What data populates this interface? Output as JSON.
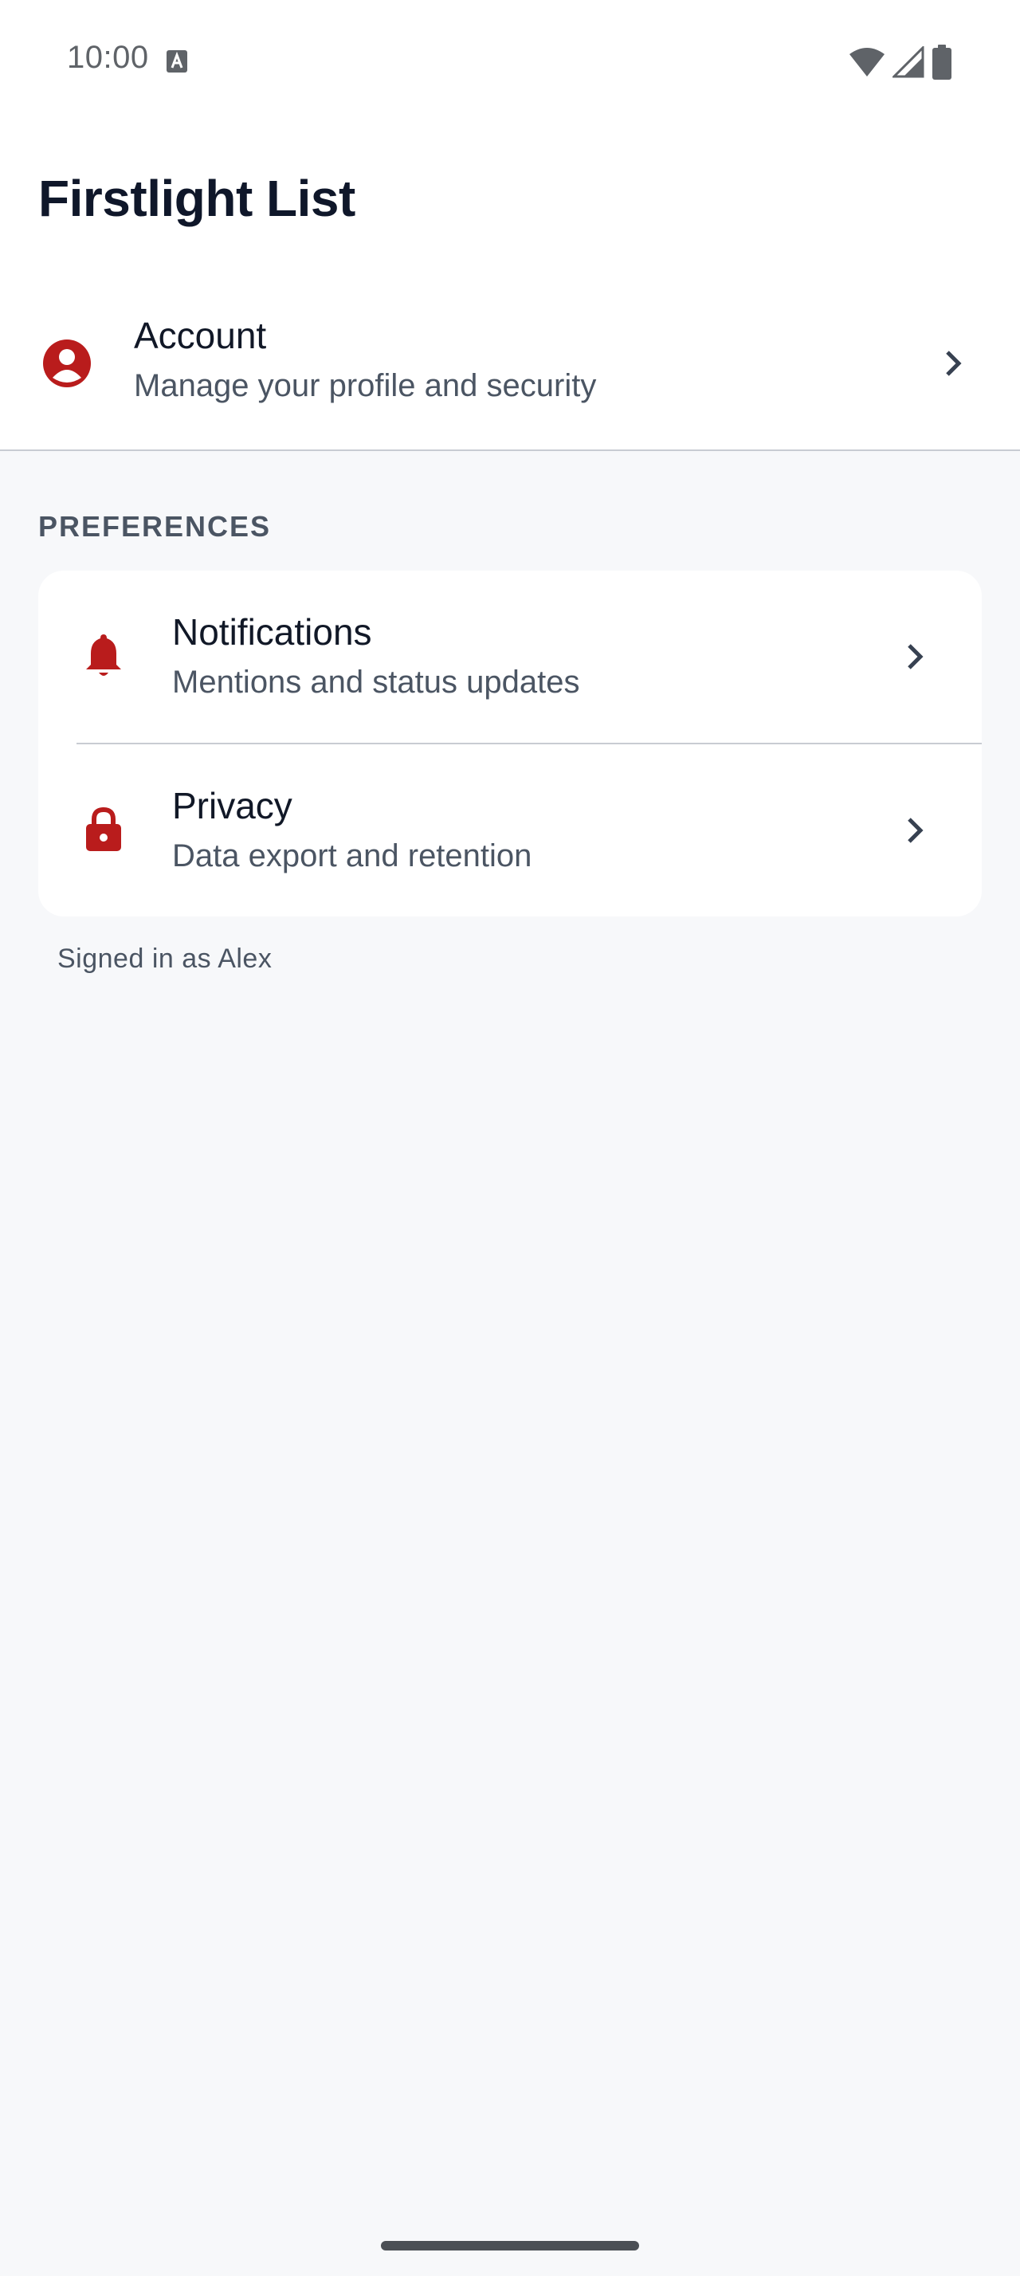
{
  "status_bar": {
    "time": "10:00",
    "icons": [
      "keyboard-a-icon",
      "wifi-icon",
      "signal-icon",
      "battery-icon"
    ]
  },
  "header": {
    "title": "Firstlight List"
  },
  "account": {
    "title": "Account",
    "subtitle": "Manage your profile and security",
    "icon": "account-circle-icon"
  },
  "preferences": {
    "section_label": "PREFERENCES",
    "items": [
      {
        "title": "Notifications",
        "subtitle": "Mentions and status updates",
        "icon": "bell-icon"
      },
      {
        "title": "Privacy",
        "subtitle": "Data export and retention",
        "icon": "lock-icon"
      }
    ]
  },
  "footer": {
    "signed_in": "Signed in as Alex"
  },
  "colors": {
    "accent": "#b91c1c",
    "background": "#f7f8fa",
    "surface": "#ffffff",
    "text_primary": "#111827",
    "text_secondary": "#4b5563"
  }
}
